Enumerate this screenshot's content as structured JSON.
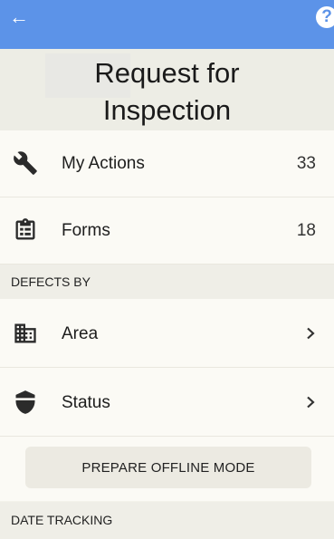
{
  "header": {
    "back_icon": "arrow-left-icon",
    "help_icon": "question-mark-icon",
    "back_glyph": "←",
    "help_glyph": "?"
  },
  "page": {
    "title": "Request for Inspection"
  },
  "menu": [
    {
      "label": "My Actions",
      "count": "33",
      "icon": "wrench-icon"
    },
    {
      "label": "Forms",
      "count": "18",
      "icon": "clipboard-icon"
    }
  ],
  "sections": {
    "defects_by": "DEFECTS BY",
    "date_tracking": "DATE TRACKING"
  },
  "defects": [
    {
      "label": "Area",
      "icon": "building-icon"
    },
    {
      "label": "Status",
      "icon": "shield-icon"
    }
  ],
  "offline": {
    "button_label": "PREPARE OFFLINE MODE"
  },
  "colors": {
    "header": "#5c93e8",
    "background": "#f3f2ea",
    "row": "#fbfaf5",
    "icon": "#2b2b2b"
  }
}
